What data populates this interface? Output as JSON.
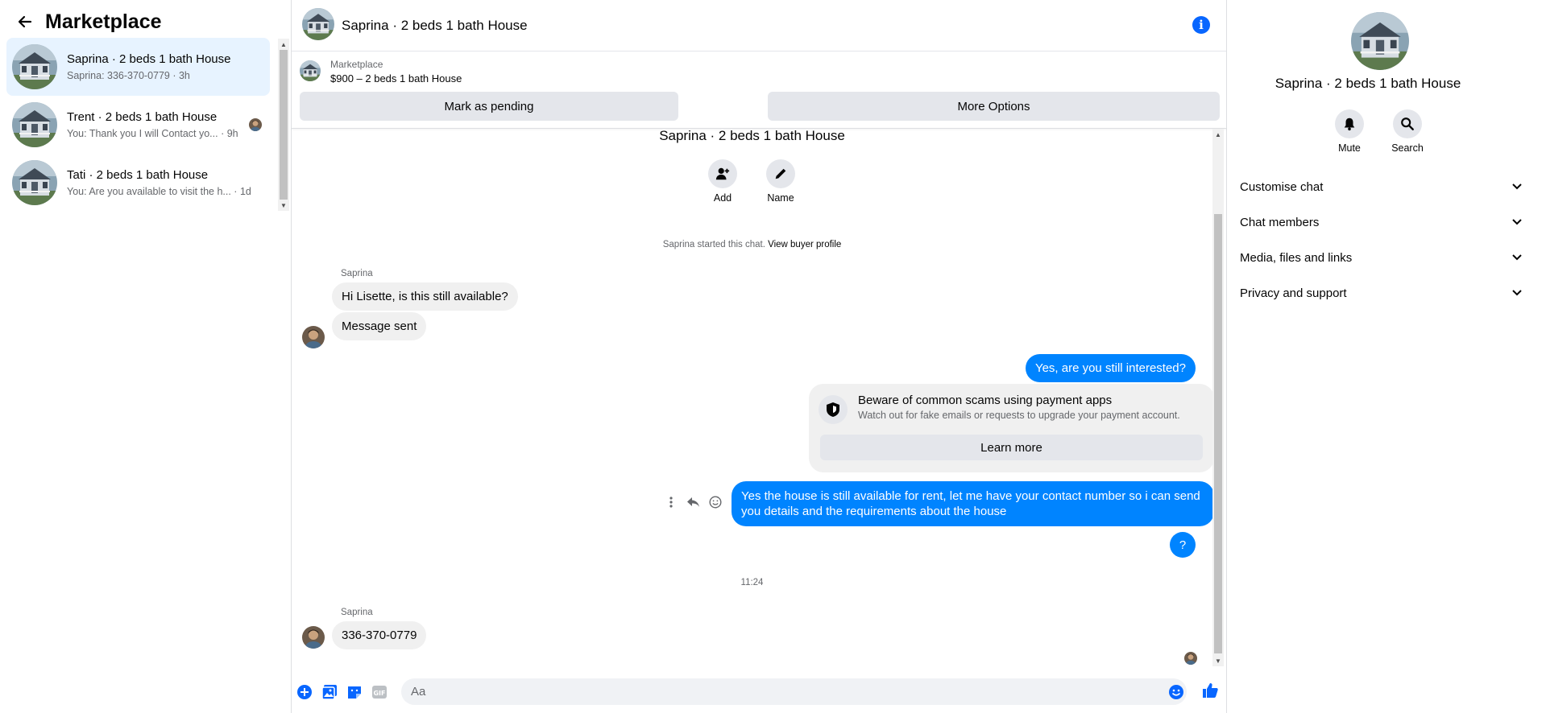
{
  "sidebar": {
    "title": "Marketplace",
    "conversations": [
      {
        "name": "Saprina · 2 beds 1 bath House",
        "preview": "Saprina: 336-370-0779 · 3h",
        "active": true
      },
      {
        "name": "Trent · 2 beds 1 bath House",
        "preview": "You: Thank you I will Contact yo... · 9h",
        "active": false
      },
      {
        "name": "Tati · 2 beds 1 bath House",
        "preview": "You: Are you available to visit the h... · 1d",
        "active": false
      }
    ]
  },
  "chat": {
    "header_title": "Saprina · 2 beds 1 bath House",
    "marketplace_label": "Marketplace",
    "listing_price": "$900 – 2 beds 1 bath House",
    "mark_pending": "Mark as pending",
    "more_options": "More Options",
    "thread_title": "Saprina · 2 beds 1 bath House",
    "add_label": "Add",
    "name_label": "Name",
    "system_text": "Saprina started this chat.",
    "system_link": "View buyer profile",
    "sender1": "Saprina",
    "msg1": "Hi Lisette, is this still available?",
    "msg2": "Message sent",
    "out1": "Yes, are you still interested?",
    "scam_title": "Beware of common scams using payment apps",
    "scam_desc": "Watch out for fake emails or requests to upgrade your payment account.",
    "learn_more": "Learn more",
    "out2": "Yes the house is still available for rent, let me have your contact number so i can send you details and the requirements about the house",
    "out3": "?",
    "timestamp": "11:24",
    "sender2": "Saprina",
    "msg3": "336-370-0779",
    "composer_placeholder": "Aa"
  },
  "details": {
    "name": "Saprina · 2 beds 1 bath House",
    "mute": "Mute",
    "search": "Search",
    "sections": [
      "Customise chat",
      "Chat members",
      "Media, files and links",
      "Privacy and support"
    ]
  },
  "colors": {
    "accent": "#0084ff",
    "icon_blue": "#0866ff",
    "active_bg": "#e7f3ff",
    "bubble_in": "#f0f0f0"
  }
}
